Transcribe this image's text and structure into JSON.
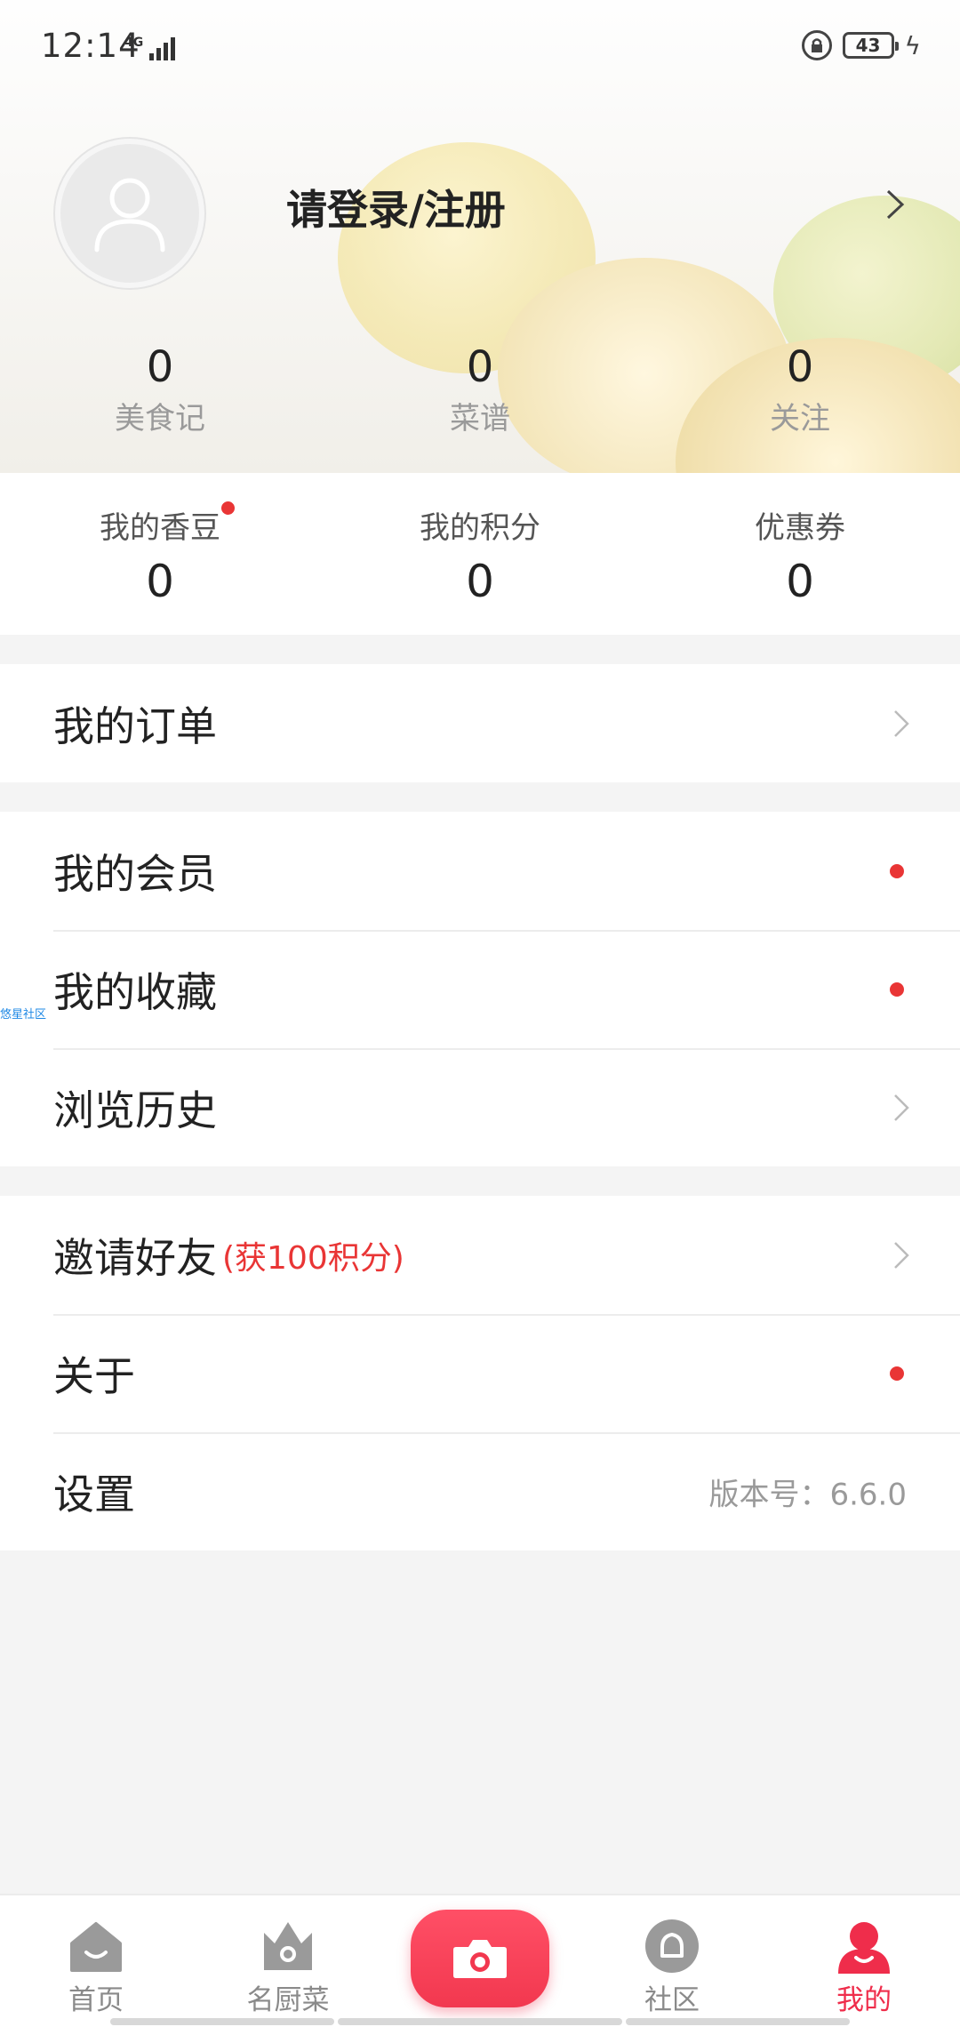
{
  "status": {
    "time": "12:14",
    "network": "4G",
    "battery": "43"
  },
  "profile": {
    "login_text": "请登录/注册"
  },
  "stats": [
    {
      "value": "0",
      "label": "美食记"
    },
    {
      "value": "0",
      "label": "菜谱"
    },
    {
      "value": "0",
      "label": "关注"
    }
  ],
  "wallet": [
    {
      "label": "我的香豆",
      "value": "0",
      "has_dot": true
    },
    {
      "label": "我的积分",
      "value": "0"
    },
    {
      "label": "优惠券",
      "value": "0"
    }
  ],
  "menu": {
    "orders": "我的订单",
    "membership": "我的会员",
    "favorites": "我的收藏",
    "history": "浏览历史",
    "invite": "邀请好友",
    "invite_reward": "(获100积分)",
    "about": "关于",
    "settings": "设置",
    "version": "版本号：6.6.0"
  },
  "floating_label": "悠星社区",
  "tabs": [
    "首页",
    "名厨菜",
    "社区",
    "我的"
  ],
  "colors": {
    "accent": "#ef2d4b",
    "dot": "#e93535"
  }
}
